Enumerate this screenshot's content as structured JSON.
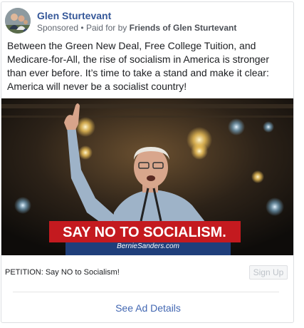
{
  "post": {
    "page_name": "Glen Sturtevant",
    "sponsored_label": "Sponsored",
    "separator": "•",
    "paid_for_prefix": "Paid for by",
    "paid_for_name": "Friends of Glen Sturtevant",
    "body_text": "Between the Green New Deal, Free College Tuition, and Medicare-for-All, the rise of socialism in America is stronger than ever before. It’s time to take a stand and make it clear: America will never be a socialist country!"
  },
  "image": {
    "banner_text": "SAY NO TO SOCIALISM.",
    "podium_text": "BernieSanders.com",
    "banner_color": "#c41a1f"
  },
  "cta": {
    "headline": "PETITION: Say NO to Socialism!",
    "button_label": "Sign Up"
  },
  "footer": {
    "link_label": "See Ad Details",
    "link_color": "#4267b2"
  },
  "icons": {
    "avatar": "profile-photo"
  }
}
